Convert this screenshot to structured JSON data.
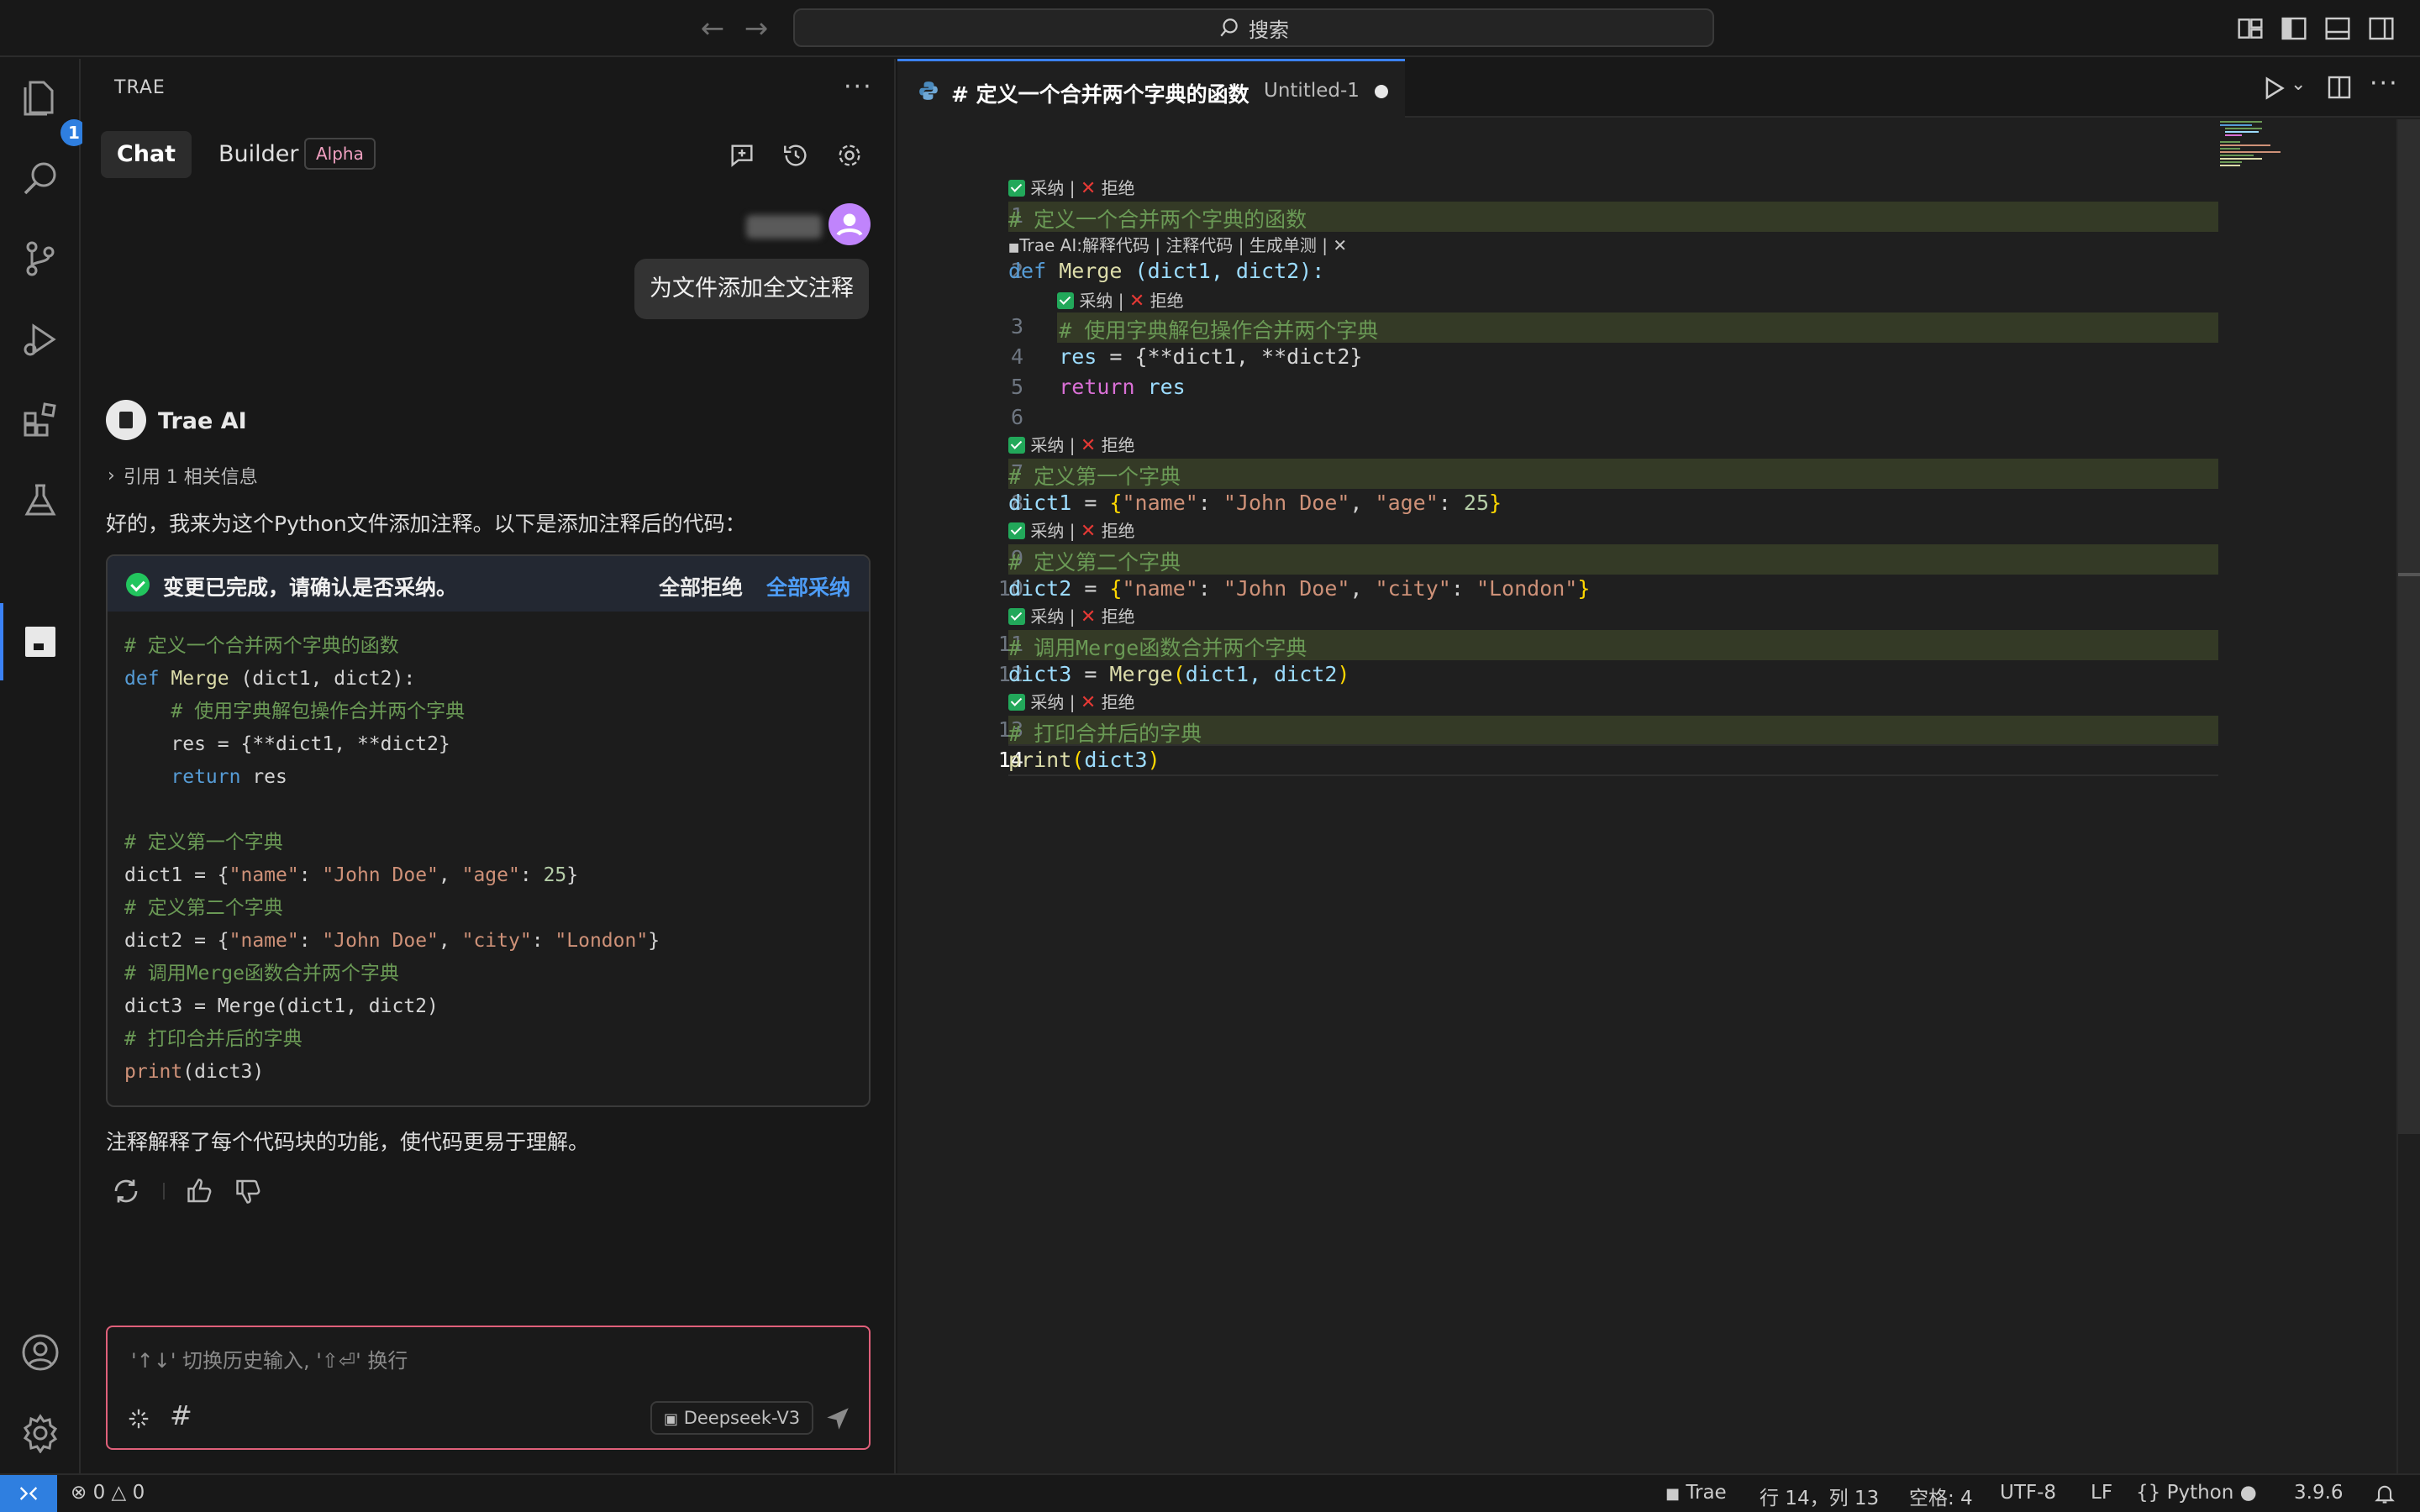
{
  "titlebar": {
    "search_label": "搜索"
  },
  "activitybar": {
    "explorer_badge": "1"
  },
  "chat": {
    "panel_title": "TRAE",
    "tabs": {
      "chat": "Chat",
      "builder": "Builder",
      "builder_badge": "Alpha"
    },
    "user_message": "为文件添加全文注释",
    "ai_name": "Trae AI",
    "reference": "引用 1 相关信息",
    "intro": "好的，我来为这个Python文件添加注释。以下是添加注释后的代码：",
    "card": {
      "status": "变更已完成，请确认是否采纳。",
      "reject_all": "全部拒绝",
      "accept_all": "全部采纳",
      "code": {
        "c1": "# 定义一个合并两个字典的函数",
        "def_kw": "def",
        "fn_name": "Merge",
        "fn_sig": " (dict1, dict2):",
        "c2": "    # 使用字典解包操作合并两个字典",
        "res": "    res = {**dict1, **dict2}",
        "ret_kw": "    return",
        "ret_val": " res",
        "c3": "# 定义第一个字典",
        "d1_pre": "dict1 = {",
        "d1_k1": "\"name\"",
        "d1_sep1": ": ",
        "d1_v1": "\"John Doe\"",
        "d1_sep2": ", ",
        "d1_k2": "\"age\"",
        "d1_sep3": ": ",
        "d1_v2": "25",
        "d1_end": "}",
        "c4": "# 定义第二个字典",
        "d2_pre": "dict2 = {",
        "d2_k1": "\"name\"",
        "d2_v1": "\"John Doe\"",
        "d2_k2": "\"city\"",
        "d2_v2": "\"London\"",
        "d2_end": "}",
        "c5": "# 调用Merge函数合并两个字典",
        "d3": "dict3 = Merge(dict1, dict2)",
        "c6": "# 打印合并后的字典",
        "print_kw": "print",
        "print_args": "(dict3)"
      }
    },
    "outro": "注释解释了每个代码块的功能，使代码更易于理解。",
    "input_placeholder": "'↑↓' 切换历史输入, '⇧⏎' 换行",
    "hash_label": "#",
    "model": "Deepseek-V3"
  },
  "editor": {
    "tab_title": "# 定义一个合并两个字典的函数",
    "tab_file": "Untitled-1",
    "accept": "采纳",
    "reject": "拒绝",
    "lens_sep": " | ",
    "ai_lens": "Trae AI:解释代码 | 注释代码 | 生成单测 | ✕",
    "line_numbers": [
      "1",
      "2",
      "3",
      "4",
      "5",
      "6",
      "7",
      "8",
      "9",
      "10",
      "11",
      "12",
      "13",
      "14"
    ],
    "lines": {
      "l1": "# 定义一个合并两个字典的函数",
      "l2_kw": "def",
      "l2_fn": " Merge",
      "l2_rest": " (dict1, dict2):",
      "l3": "    # 使用字典解包操作合并两个字典",
      "l4_var": "    res",
      "l4_rest": " = {**dict1, **dict2}",
      "l5_kw": "    return",
      "l5_var": " res",
      "l7": "# 定义第一个字典",
      "l8_var": "dict1",
      "l8_eq": " = ",
      "l8_ob": "{",
      "l8_k1": "\"name\"",
      "l8_c1": ": ",
      "l8_v1": "\"John Doe\"",
      "l8_cm": ", ",
      "l8_k2": "\"age\"",
      "l8_c2": ": ",
      "l8_v2": "25",
      "l8_cb": "}",
      "l9": "# 定义第二个字典",
      "l10_var": "dict2",
      "l10_k1": "\"name\"",
      "l10_v1": "\"John Doe\"",
      "l10_k2": "\"city\"",
      "l10_v2": "\"London\"",
      "l11": "# 调用Merge函数合并两个字典",
      "l12_var": "dict3",
      "l12_fn": "Merge",
      "l12_args": "dict1, dict2",
      "l13": "# 打印合并后的字典",
      "l14_fn": "print",
      "l14_arg": "dict3"
    }
  },
  "statusbar": {
    "errors": "0",
    "warnings": "0",
    "app": "Trae",
    "position": "行 14，列 13",
    "spaces": "空格: 4",
    "encoding": "UTF-8",
    "eol": "LF",
    "language": "Python",
    "version": "3.9.6"
  },
  "colors": {
    "accent": "#3b82f6",
    "accept_blue": "#4d9cf6",
    "input_border": "#e0607a",
    "diff_highlight": "#343a26"
  }
}
